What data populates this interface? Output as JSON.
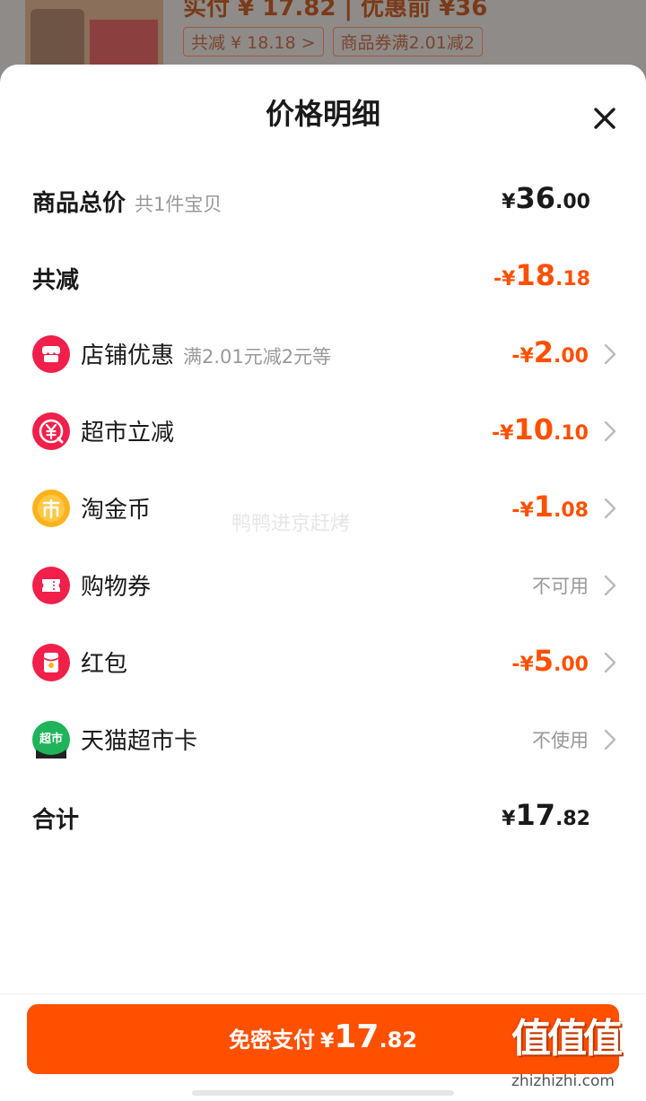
{
  "background_page": {
    "pay_line": "实付 ¥ 17.82 | 优惠前 ¥36",
    "tag_discount": "共减 ¥ 18.18 >",
    "tag_coupon": "商品券满2.01减2"
  },
  "sheet": {
    "title": "价格明细",
    "close_icon": "close-icon"
  },
  "total_goods": {
    "label": "商品总价",
    "sub": "共1件宝贝",
    "currency": "¥",
    "int": "36",
    "dec": ".00"
  },
  "total_discount": {
    "label": "共减",
    "prefix": "-",
    "currency": "¥",
    "int": "18",
    "dec": ".18"
  },
  "discounts": [
    {
      "icon": "shop-icon",
      "label": "店铺优惠",
      "sub": "满2.01元减2元等",
      "prefix": "-",
      "currency": "¥",
      "int": "2",
      "dec": ".00",
      "color": "#ff5000"
    },
    {
      "icon": "yuan-minus-icon",
      "label": "超市立减",
      "sub": "",
      "prefix": "-",
      "currency": "¥",
      "int": "10",
      "dec": ".10",
      "color": "#ff5000"
    },
    {
      "icon": "coin-icon",
      "label": "淘金币",
      "sub": "",
      "prefix": "-",
      "currency": "¥",
      "int": "1",
      "dec": ".08",
      "color": "#ff5000"
    },
    {
      "icon": "ticket-icon",
      "label": "购物券",
      "sub": "",
      "status": "不可用"
    },
    {
      "icon": "red-envelope-icon",
      "label": "红包",
      "sub": "",
      "prefix": "-",
      "currency": "¥",
      "int": "5",
      "dec": ".00",
      "color": "#ff5000"
    },
    {
      "icon": "tmall-supermarket-card-icon",
      "icon_text": "超市",
      "label": "天猫超市卡",
      "sub": "",
      "status": "不使用"
    }
  ],
  "total": {
    "label": "合计",
    "currency": "¥",
    "int": "17",
    "dec": ".82"
  },
  "watermark": "鸭鸭进京赶烤",
  "pay_button": {
    "label": "免密支付",
    "currency": "¥",
    "int": "17",
    "dec": ".82"
  },
  "logo": {
    "main": "值值值",
    "sub": "zhizhizhi.com"
  },
  "colors": {
    "accent": "#ff5000",
    "text": "#1a1a1a",
    "muted": "#999999"
  }
}
